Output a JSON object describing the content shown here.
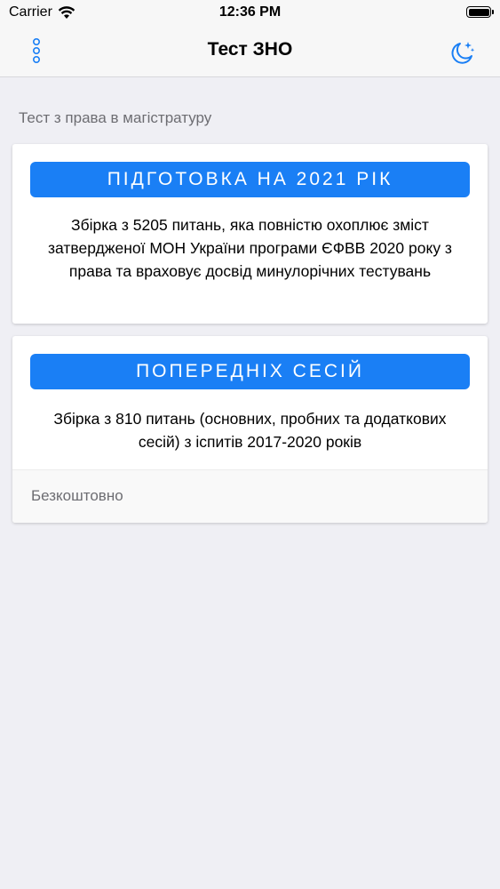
{
  "status_bar": {
    "carrier": "Carrier",
    "time": "12:36 PM"
  },
  "nav": {
    "title": "Тест ЗНО",
    "left_icon": "vertical-dots-icon",
    "right_icon": "moon-stars-icon"
  },
  "section": {
    "header": "Тест з права в магістратуру"
  },
  "cards": [
    {
      "button_label": "ПІДГОТОВКА НА 2021 РІК",
      "description": "Збірка з 5205 питань, яка повністю охоплює зміст затвердженої МОН України програми ЄФВВ 2020 року з права та враховує досвід минулорічних тестувань"
    },
    {
      "button_label": "ПОПЕРЕДНІХ СЕСІЙ",
      "description": "Збірка з 810 питань (основних, пробних та додаткових сесій) з іспитів 2017-2020 років",
      "footer": "Безкоштовно"
    }
  ],
  "colors": {
    "accent": "#1a7ff5",
    "background": "#efeff4",
    "icon_tint": "#1a7ff5"
  }
}
